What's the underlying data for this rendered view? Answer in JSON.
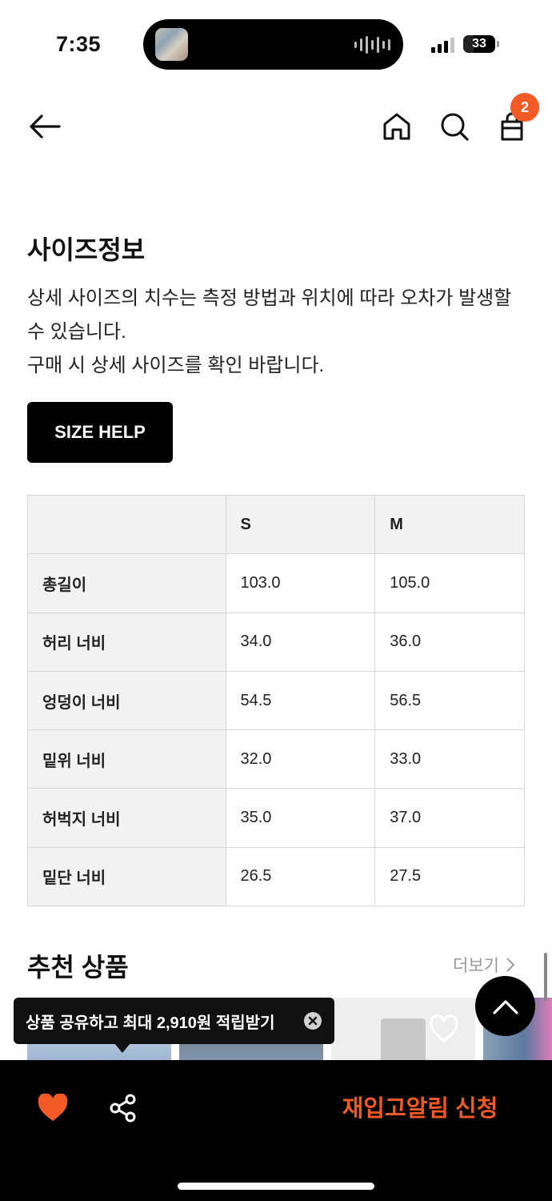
{
  "status_bar": {
    "time": "7:35",
    "battery_level": "33"
  },
  "nav": {
    "cart_count": "2",
    "icons": [
      "back-arrow-icon",
      "home-icon",
      "search-icon",
      "bag-icon"
    ]
  },
  "size_info": {
    "title": "사이즈정보",
    "description_line1": "상세 사이즈의 치수는 측정 방법과 위치에 따라 오차가 발생할 수 있습니다.",
    "description_line2": "구매 시 상세 사이즈를 확인 바랍니다.",
    "size_help_label": "SIZE HELP",
    "table": {
      "columns": [
        "",
        "S",
        "M"
      ],
      "rows": [
        {
          "label": "총길이",
          "s": "103.0",
          "m": "105.0"
        },
        {
          "label": "허리 너비",
          "s": "34.0",
          "m": "36.0"
        },
        {
          "label": "엉덩이 너비",
          "s": "54.5",
          "m": "56.5"
        },
        {
          "label": "밑위 너비",
          "s": "32.0",
          "m": "33.0"
        },
        {
          "label": "허벅지 너비",
          "s": "35.0",
          "m": "37.0"
        },
        {
          "label": "밑단 너비",
          "s": "26.5",
          "m": "27.5"
        }
      ]
    }
  },
  "recommended": {
    "title": "추천 상품",
    "more_label": "더보기"
  },
  "tooltip": {
    "text": "상품 공유하고 최대 2,910원 적립받기"
  },
  "bottom_bar": {
    "restock_label": "재입고알림 신청"
  },
  "colors": {
    "accent": "#f15a24",
    "bottom_bar_bg": "#000000",
    "table_header_bg": "#f2f2f2"
  }
}
